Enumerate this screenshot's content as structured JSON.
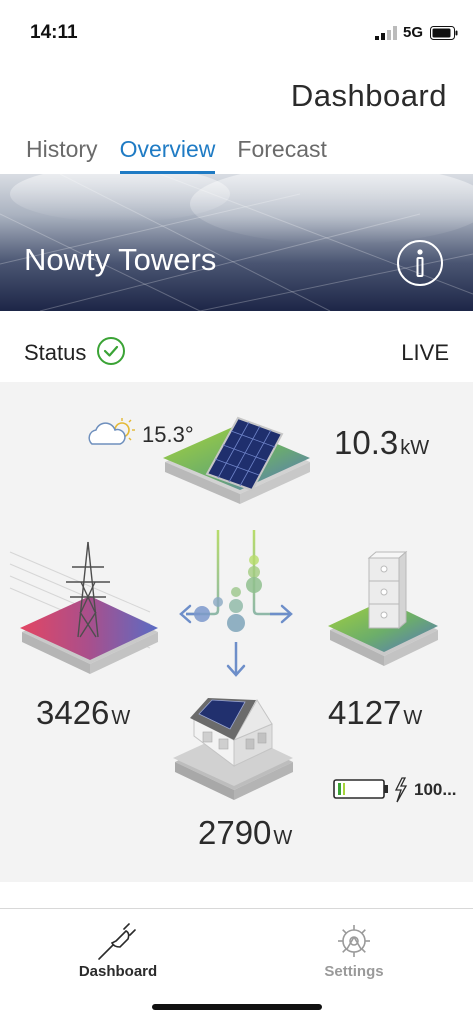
{
  "status_bar": {
    "time": "14:11",
    "network": "5G"
  },
  "header": {
    "title": "Dashboard"
  },
  "tabs": [
    {
      "label": "History",
      "active": false
    },
    {
      "label": "Overview",
      "active": true
    },
    {
      "label": "Forecast",
      "active": false
    }
  ],
  "hero": {
    "site_name": "Nowty Towers",
    "info_icon": "info-icon"
  },
  "status": {
    "label": "Status",
    "state_icon": "check-circle-icon",
    "mode": "LIVE"
  },
  "energy": {
    "weather": {
      "icon": "partly-cloudy-icon",
      "temperature": "15.3°"
    },
    "solar": {
      "value": "10.3",
      "unit": "kW"
    },
    "grid": {
      "value": "3426",
      "unit": "W"
    },
    "battery": {
      "value": "4127",
      "unit": "W",
      "charge": "100..."
    },
    "home": {
      "value": "2790",
      "unit": "W"
    }
  },
  "nav": {
    "items": [
      {
        "label": "Dashboard",
        "icon": "plug-icon",
        "active": true
      },
      {
        "label": "Settings",
        "icon": "gear-icon",
        "active": false
      }
    ]
  },
  "colors": {
    "accent": "#1f7bc4",
    "check": "#3aa335",
    "inactive": "#9a9a9a"
  }
}
